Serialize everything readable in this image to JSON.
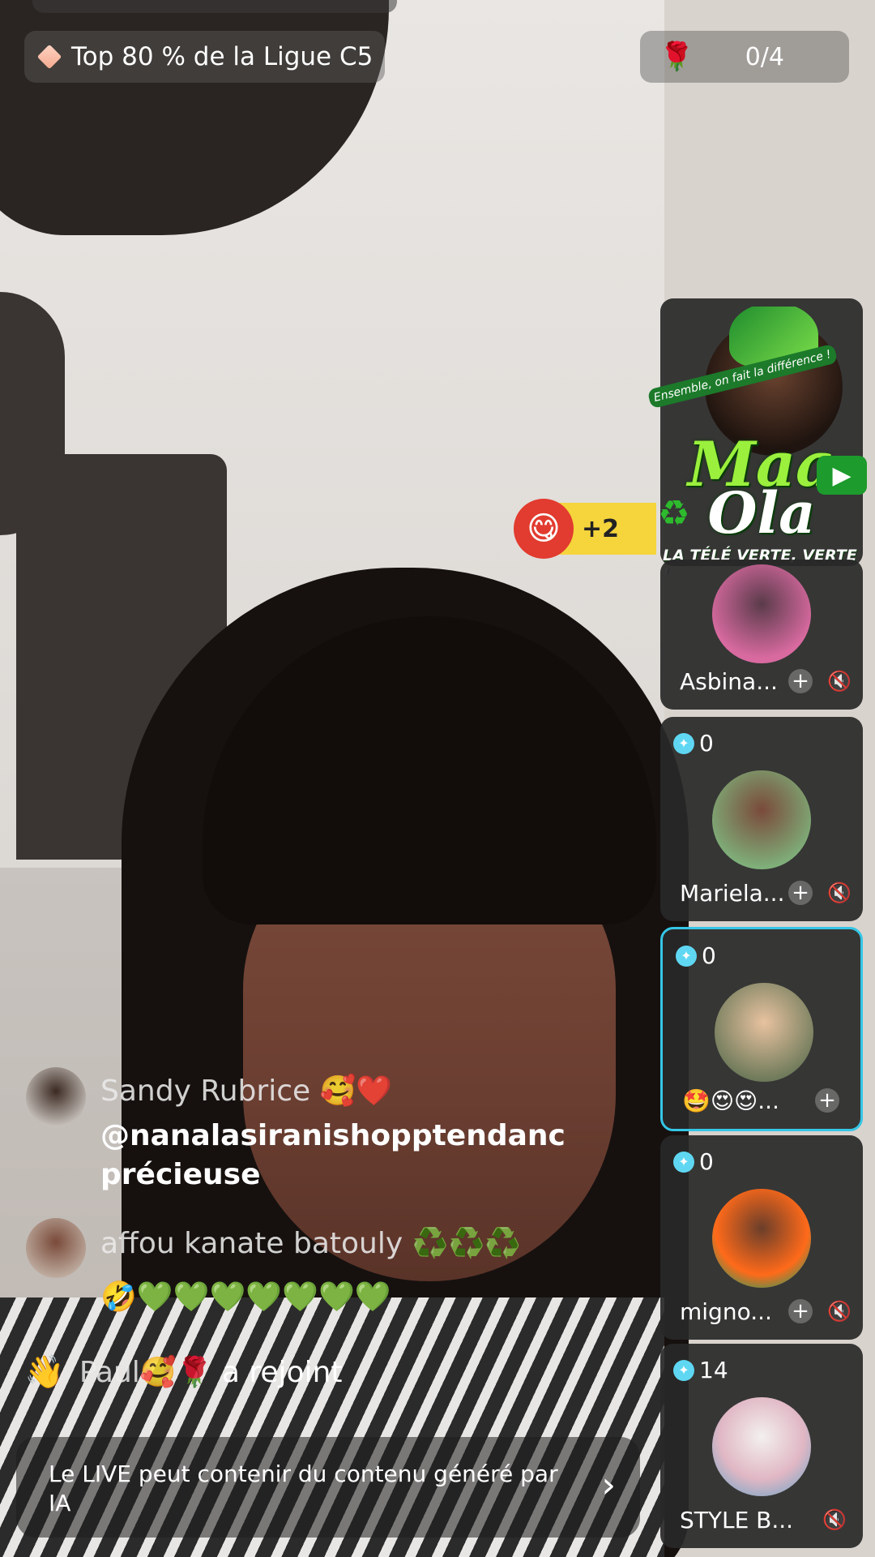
{
  "header": {
    "league_label": "Top 80 % de la Ligue C5",
    "goal_count": "0/4",
    "goal_icon": "rose-icon",
    "league_icon": "diamond-icon"
  },
  "promo": {
    "logo_line1": "Maa",
    "logo_line2": "Ola",
    "tagline": "LA TÉLÉ VERTE, VERTE !",
    "ribbon": "Ensemble, on fait la différence !"
  },
  "reaction": {
    "count": "+2"
  },
  "guests": [
    {
      "name": "Asbina...",
      "score": null
    },
    {
      "name": "Mariela...",
      "score": "0"
    },
    {
      "name": "🤩😍😍...",
      "score": "0"
    },
    {
      "name": "migno...",
      "score": "0"
    },
    {
      "name": "STYLE B...",
      "score": "14"
    }
  ],
  "chat": [
    {
      "user": "Sandy Rubrice 🥰❤️",
      "message_line1": "@nanalasiranishopptendanc",
      "message_line2": "précieuse"
    },
    {
      "user": "affou kanate batouly ♻️♻️♻️",
      "message_line1": "🤣💚💚💚💚💚💚💚"
    }
  ],
  "join": {
    "user": "Paul🥰🌹",
    "action": "a rejoint"
  },
  "notice": {
    "text": "Le LIVE peut contenir du contenu généré par IA"
  },
  "colors": {
    "active_border": "#35c6e6",
    "gem": "#5fd7f2",
    "brand_green": "#9af03c"
  }
}
